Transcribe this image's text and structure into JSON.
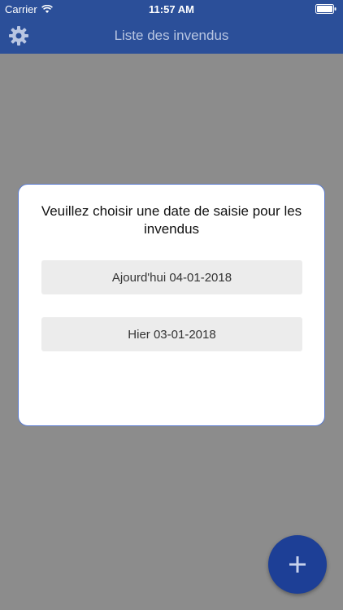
{
  "status_bar": {
    "carrier": "Carrier",
    "time": "11:57 AM",
    "wifi_icon": "wifi-icon",
    "battery_icon": "battery-icon"
  },
  "nav": {
    "title": "Liste des invendus",
    "settings_icon": "gear-icon"
  },
  "dialog": {
    "title": "Veuillez choisir une date de saisie pour les invendus",
    "options": [
      {
        "label": "Ajourd'hui 04-01-2018"
      },
      {
        "label": "Hier 03-01-2018"
      }
    ]
  },
  "fab": {
    "icon": "plus-icon"
  },
  "colors": {
    "nav_bg_dimmed": "#2b4f99",
    "overlay_gray": "#8c8c8c",
    "fab_blue": "#1d3f96",
    "dialog_border": "#5a7bd0"
  }
}
